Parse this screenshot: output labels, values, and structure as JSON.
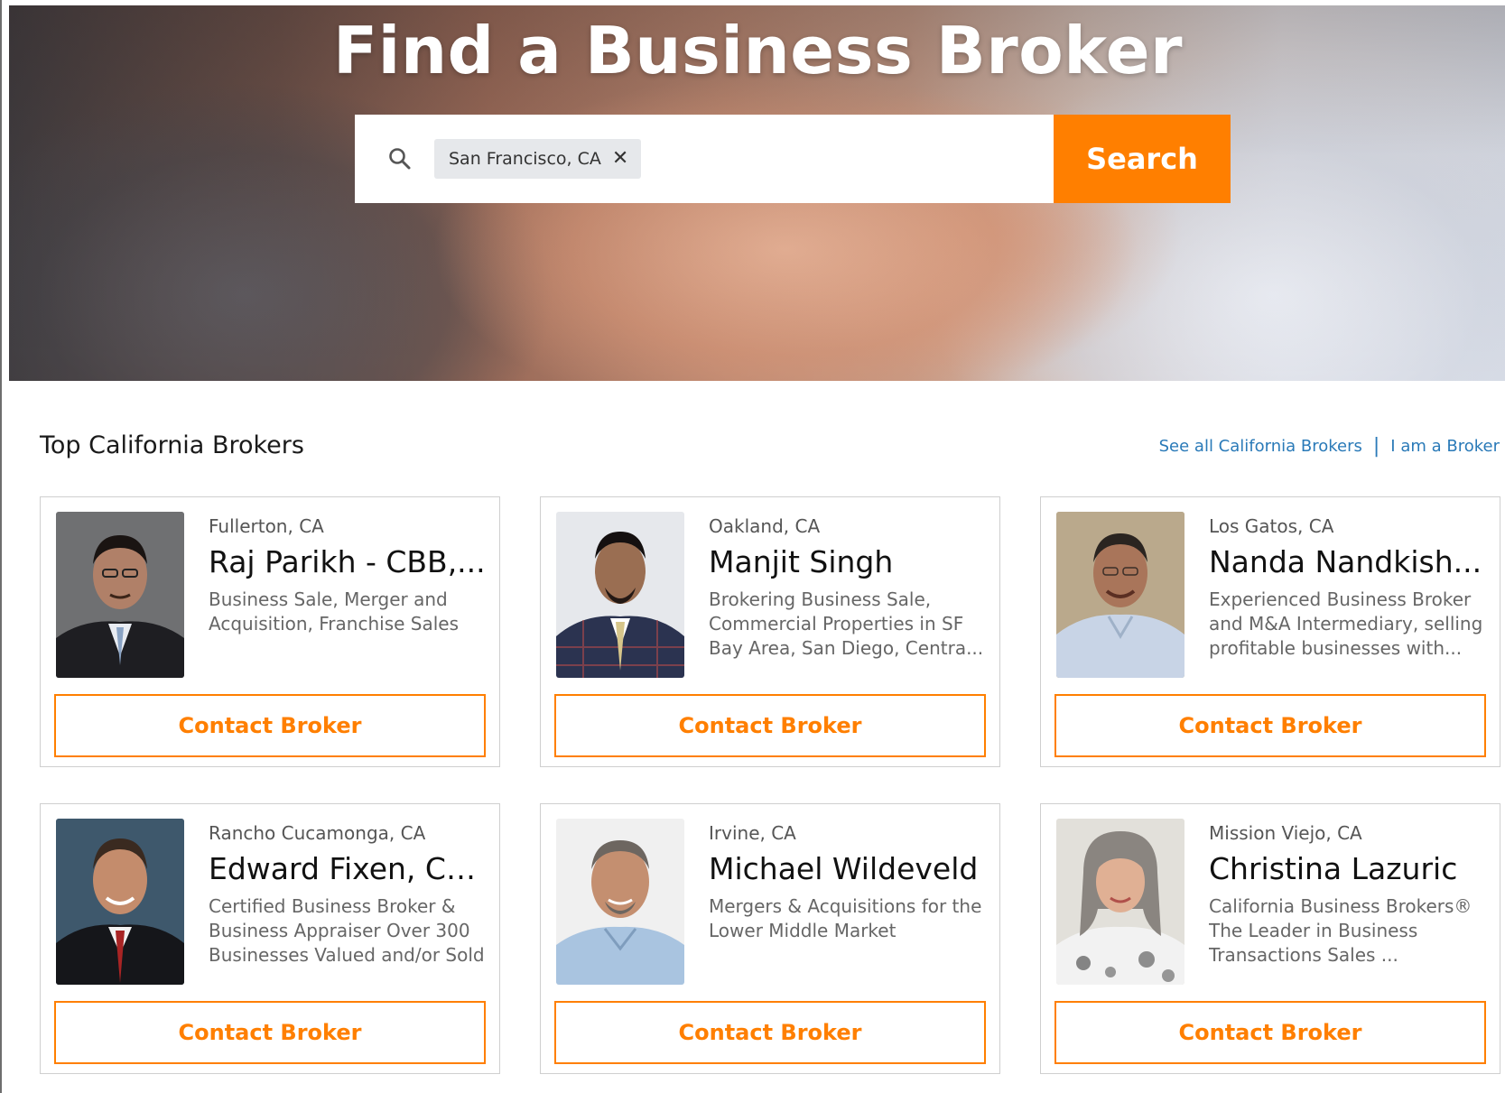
{
  "hero": {
    "title": "Find a Business Broker"
  },
  "search": {
    "chip_label": "San Francisco, CA",
    "chip_remove": "✕",
    "button_label": "Search",
    "accent_color": "#ff7f00"
  },
  "section": {
    "title": "Top California Brokers",
    "links": {
      "see_all": "See all California Brokers",
      "separator": "|",
      "i_am_broker": "I am a Broker"
    }
  },
  "brokers": [
    {
      "location": "Fullerton, CA",
      "name": "Raj Parikh - CBB,...",
      "description": "Business Sale, Merger and Acquisition, Franchise Sales",
      "button": "Contact Broker"
    },
    {
      "location": "Oakland, CA",
      "name": "Manjit Singh",
      "description": "Brokering Business Sale, Commercial Properties in SF Bay Area, San Diego, Centra...",
      "button": "Contact Broker"
    },
    {
      "location": "Los Gatos, CA",
      "name": "Nanda Nandkish...",
      "description": "Experienced Business Broker and M&A Intermediary, selling profitable businesses with...",
      "button": "Contact Broker"
    },
    {
      "location": "Rancho Cucamonga, CA",
      "name": "Edward Fixen, Ce...",
      "description": "Certified Business Broker & Business Appraiser Over 300 Businesses Valued and/or Sold",
      "button": "Contact Broker"
    },
    {
      "location": "Irvine, CA",
      "name": "Michael Wildeveld",
      "description": "Mergers & Acquisitions for the Lower Middle Market",
      "button": "Contact Broker"
    },
    {
      "location": "Mission Viejo, CA",
      "name": "Christina Lazuric",
      "description": "California Business Brokers® The Leader in Business Transactions Sales ...",
      "button": "Contact Broker"
    }
  ]
}
